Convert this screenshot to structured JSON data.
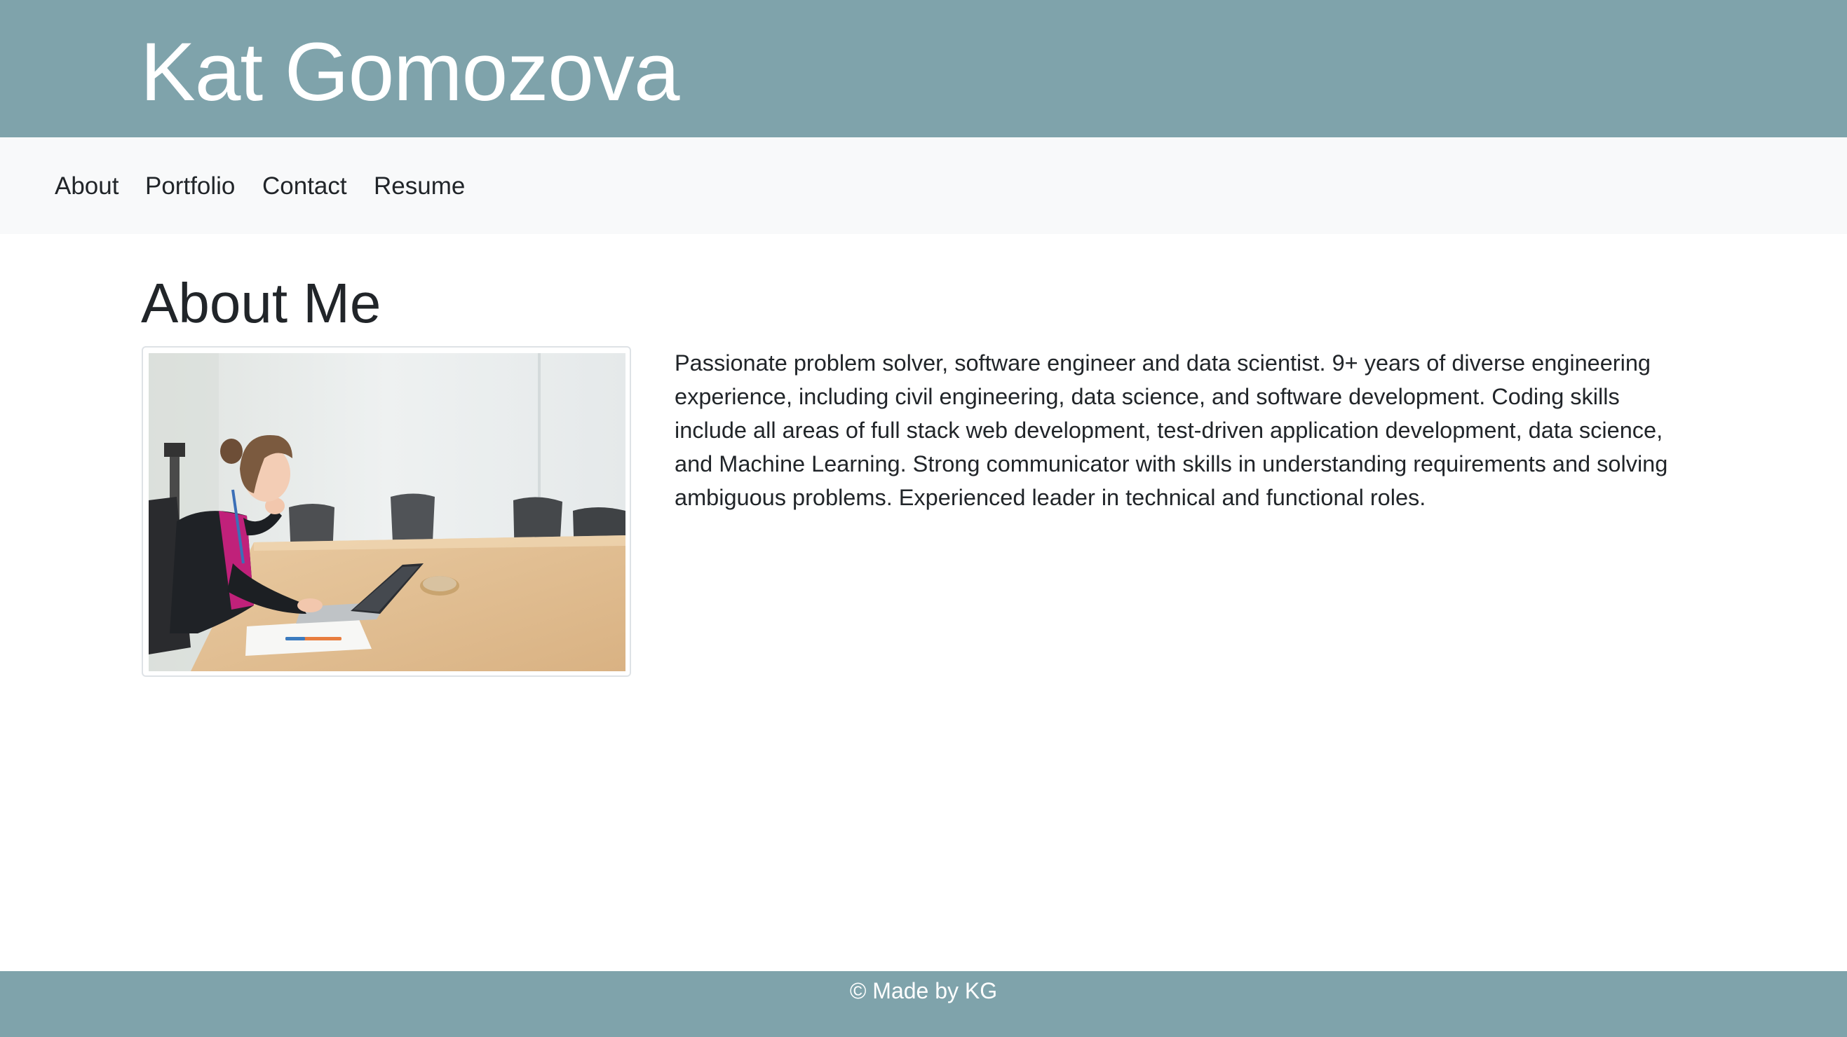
{
  "header": {
    "site_title": "Kat Gomozova"
  },
  "nav": {
    "items": [
      {
        "label": "About"
      },
      {
        "label": "Portfolio"
      },
      {
        "label": "Contact"
      },
      {
        "label": "Resume"
      }
    ]
  },
  "main": {
    "section_title": "About Me",
    "photo_alt": "Woman working on a laptop at a conference table",
    "bio": "Passionate problem solver, software engineer and data scientist. 9+ years of diverse engineering experience, including civil engineering, data science, and software development. Coding skills include all areas of full stack web development, test-driven application development, data science, and Machine Learning. Strong communicator with skills in understanding requirements and solving ambiguous problems. Experienced leader in technical and functional roles."
  },
  "footer": {
    "text": "© Made by KG"
  },
  "colors": {
    "header_bg": "#7fa3ab",
    "nav_bg": "#f8f9fa",
    "footer_bg": "#7fa3ab",
    "text": "#212529"
  }
}
